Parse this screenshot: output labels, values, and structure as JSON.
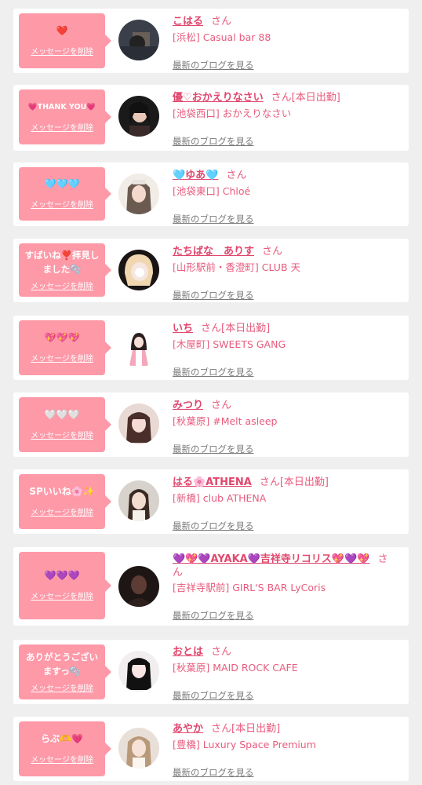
{
  "delete_label": "メッセージを削除",
  "blog_label": "最新のブログを見る",
  "items": [
    {
      "stamp": "❤️",
      "name": "こはる",
      "san": "さん",
      "badge": "",
      "shop": "[浜松] Casual bar 88"
    },
    {
      "stamp": "💗THANK YOU💗",
      "name": "優♡おかえりなさい",
      "san": "さん",
      "badge": "[本日出勤]",
      "shop": "[池袋西口] おかえりなさい"
    },
    {
      "stamp": "🩵🩵🩵",
      "name": "🩵ゆあ🩵",
      "san": "さん",
      "badge": "",
      "shop": "[池袋東口] Chloé"
    },
    {
      "stamp": "すばいね❣️拝見し\nました🫧",
      "name": "たちばな　ありす",
      "san": "さん",
      "badge": "",
      "shop": "[山形駅前・香澄町] CLUB 天"
    },
    {
      "stamp": "💖💖💖",
      "name": "いち",
      "san": "さん",
      "badge": "[本日出勤]",
      "shop": "[木屋町] SWEETS GANG"
    },
    {
      "stamp": "🤍🤍🤍",
      "name": "みつり",
      "san": "さん",
      "badge": "",
      "shop": "[秋葉原] #Melt asleep"
    },
    {
      "stamp": "SPいいね🌸✨",
      "name": "はる🌸ATHENA",
      "san": "さん",
      "badge": "[本日出勤]",
      "shop": "[新橋] club ATHENA"
    },
    {
      "stamp": "💜💜💜",
      "name": "💜💖💜AYAKA💜吉祥寺リコリス💖💜💖",
      "san": "さん",
      "badge": "",
      "shop": "[吉祥寺駅前] GIRL'S BAR LyCoris"
    },
    {
      "stamp": "ありがとうござい\nますっ🫧",
      "name": "おとは",
      "san": "さん",
      "badge": "",
      "shop": "[秋葉原] MAID ROCK CAFE"
    },
    {
      "stamp": "らぶ🫶💗",
      "name": "あやか",
      "san": "さん",
      "badge": "[本日出勤]",
      "shop": "[豊橋] Luxury Space Premium"
    }
  ]
}
